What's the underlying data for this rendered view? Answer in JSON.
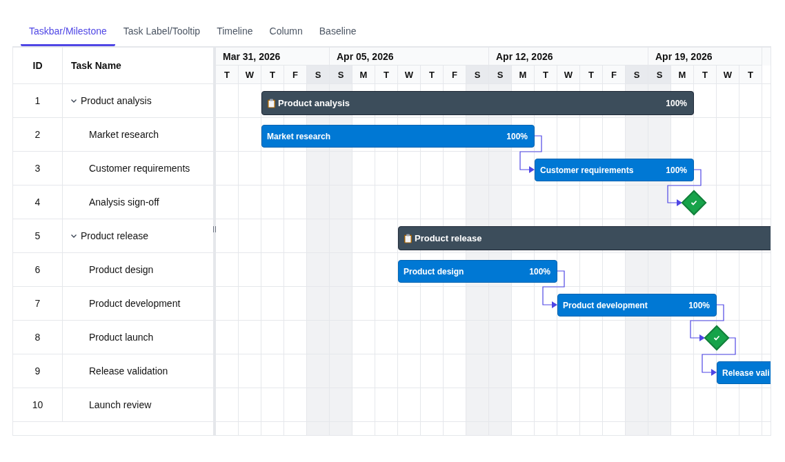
{
  "tabs": [
    {
      "label": "Taskbar/Milestone",
      "selected": true
    },
    {
      "label": "Task Label/Tooltip",
      "selected": false
    },
    {
      "label": "Timeline",
      "selected": false
    },
    {
      "label": "Column",
      "selected": false
    },
    {
      "label": "Baseline",
      "selected": false
    }
  ],
  "grid": {
    "columns": [
      "ID",
      "Task Name"
    ]
  },
  "timeline": {
    "weeks": [
      {
        "label": "Mar 31, 2026",
        "days": [
          {
            "letter": "T",
            "weekend": false
          },
          {
            "letter": "W",
            "weekend": false
          },
          {
            "letter": "T",
            "weekend": false
          },
          {
            "letter": "F",
            "weekend": false
          },
          {
            "letter": "S",
            "weekend": true
          }
        ]
      },
      {
        "label": "Apr 05, 2026",
        "days": [
          {
            "letter": "S",
            "weekend": true
          },
          {
            "letter": "M",
            "weekend": false
          },
          {
            "letter": "T",
            "weekend": false
          },
          {
            "letter": "W",
            "weekend": false
          },
          {
            "letter": "T",
            "weekend": false
          },
          {
            "letter": "F",
            "weekend": false
          },
          {
            "letter": "S",
            "weekend": true
          }
        ]
      },
      {
        "label": "Apr 12, 2026",
        "days": [
          {
            "letter": "S",
            "weekend": true
          },
          {
            "letter": "M",
            "weekend": false
          },
          {
            "letter": "T",
            "weekend": false
          },
          {
            "letter": "W",
            "weekend": false
          },
          {
            "letter": "T",
            "weekend": false
          },
          {
            "letter": "F",
            "weekend": false
          },
          {
            "letter": "S",
            "weekend": true
          }
        ]
      },
      {
        "label": "Apr 19, 2026",
        "days": [
          {
            "letter": "S",
            "weekend": true
          },
          {
            "letter": "M",
            "weekend": false
          },
          {
            "letter": "T",
            "weekend": false
          },
          {
            "letter": "W",
            "weekend": false
          },
          {
            "letter": "T",
            "weekend": false
          }
        ]
      }
    ]
  },
  "tasks": [
    {
      "id": "1",
      "name": "Product analysis",
      "expanded": true,
      "bar": {
        "kind": "summary",
        "label": "Product analysis",
        "progress": "100%"
      },
      "children": [
        {
          "id": "2",
          "name": "Market research",
          "bar": {
            "kind": "task",
            "label": "Market research",
            "progress": "100%"
          }
        },
        {
          "id": "3",
          "name": "Customer requirements",
          "bar": {
            "kind": "task",
            "label": "Customer requirements",
            "progress": "100%"
          }
        },
        {
          "id": "4",
          "name": "Analysis sign-off",
          "bar": {
            "kind": "milestone"
          }
        }
      ]
    },
    {
      "id": "5",
      "name": "Product release",
      "expanded": true,
      "bar": {
        "kind": "summary",
        "label": "Product release"
      },
      "children": [
        {
          "id": "6",
          "name": "Product design",
          "bar": {
            "kind": "task",
            "label": "Product design",
            "progress": "100%"
          }
        },
        {
          "id": "7",
          "name": "Product development",
          "bar": {
            "kind": "task",
            "label": "Product development",
            "progress": "100%"
          }
        },
        {
          "id": "8",
          "name": "Product launch",
          "bar": {
            "kind": "milestone"
          }
        },
        {
          "id": "9",
          "name": "Release validation",
          "bar": {
            "kind": "task",
            "label": "Release vali"
          }
        },
        {
          "id": "10",
          "name": "Launch review"
        }
      ]
    }
  ]
}
